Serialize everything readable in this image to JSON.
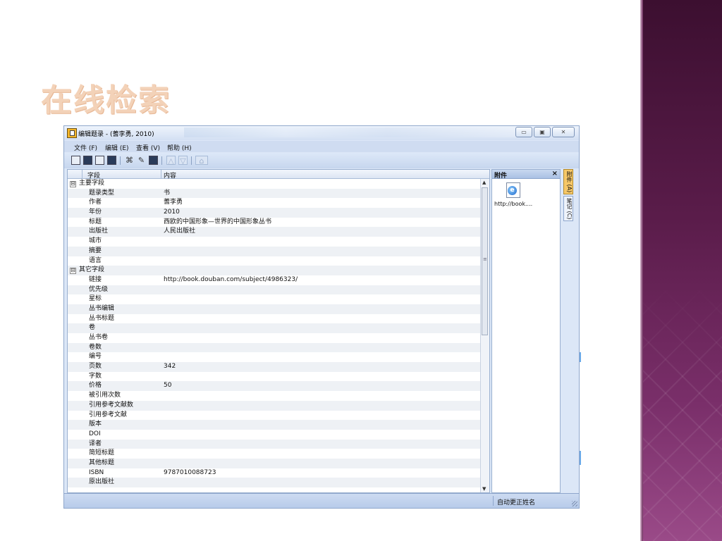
{
  "slide": {
    "title": "在线检索"
  },
  "window": {
    "title": "编辑题录 - (蓍李勇, 2010)",
    "buttons": {
      "minimize": "▭",
      "maximize": "▣",
      "close": "✕"
    }
  },
  "menu": [
    {
      "label": "文件 (F)"
    },
    {
      "label": "编辑 (E)"
    },
    {
      "label": "查看 (V)"
    },
    {
      "label": "帮助 (H)"
    }
  ],
  "grid": {
    "headers": {
      "field": "字段",
      "content": "内容"
    },
    "rows": [
      {
        "type": "group",
        "expander": "⊟",
        "label": "主要字段"
      },
      {
        "type": "row",
        "field": "题录类型",
        "value": "书"
      },
      {
        "type": "row",
        "field": "作者",
        "value": "蓍李勇"
      },
      {
        "type": "row",
        "field": "年份",
        "value": "2010"
      },
      {
        "type": "row",
        "field": "标题",
        "value": "西欧的中国形象—世界的中国形象丛书"
      },
      {
        "type": "row",
        "field": "出版社",
        "value": "人民出版社"
      },
      {
        "type": "row",
        "field": "城市",
        "value": ""
      },
      {
        "type": "row",
        "field": "摘要",
        "value": ""
      },
      {
        "type": "row",
        "field": "语言",
        "value": ""
      },
      {
        "type": "group",
        "expander": "⊟",
        "label": "其它字段"
      },
      {
        "type": "row",
        "field": "链接",
        "value": "http://book.douban.com/subject/4986323/"
      },
      {
        "type": "row",
        "field": "优先级",
        "value": ""
      },
      {
        "type": "row",
        "field": "星标",
        "value": ""
      },
      {
        "type": "row",
        "field": "丛书编辑",
        "value": ""
      },
      {
        "type": "row",
        "field": "丛书标题",
        "value": ""
      },
      {
        "type": "row",
        "field": "卷",
        "value": ""
      },
      {
        "type": "row",
        "field": "丛书卷",
        "value": ""
      },
      {
        "type": "row",
        "field": "卷数",
        "value": ""
      },
      {
        "type": "row",
        "field": "编号",
        "value": ""
      },
      {
        "type": "row",
        "field": "页数",
        "value": "342"
      },
      {
        "type": "row",
        "field": "字数",
        "value": ""
      },
      {
        "type": "row",
        "field": "价格",
        "value": "50"
      },
      {
        "type": "row",
        "field": "被引用次数",
        "value": ""
      },
      {
        "type": "row",
        "field": "引用参考文献数",
        "value": ""
      },
      {
        "type": "row",
        "field": "引用参考文献",
        "value": ""
      },
      {
        "type": "row",
        "field": "版本",
        "value": ""
      },
      {
        "type": "row",
        "field": "DOI",
        "value": ""
      },
      {
        "type": "row",
        "field": "译者",
        "value": ""
      },
      {
        "type": "row",
        "field": "简短标题",
        "value": ""
      },
      {
        "type": "row",
        "field": "其他标题",
        "value": ""
      },
      {
        "type": "row",
        "field": "ISBN",
        "value": "9787010088723"
      },
      {
        "type": "row",
        "field": "原出版社",
        "value": ""
      }
    ]
  },
  "attachments": {
    "title": "附件",
    "close": "×",
    "items": [
      {
        "label": "http://book....",
        "icon": "ie-link-icon"
      }
    ]
  },
  "side_tabs": [
    {
      "label": "附件 (A)",
      "active": true
    },
    {
      "label": "笔记 (C)",
      "active": false
    }
  ],
  "status": {
    "text": "自动更正姓名"
  }
}
